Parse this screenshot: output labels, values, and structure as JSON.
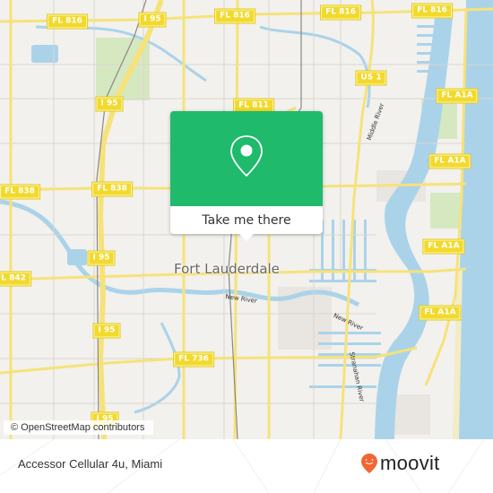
{
  "map": {
    "city_label": "Fort Lauderdale",
    "road_shields": [
      {
        "label": "FL 816"
      },
      {
        "label": "I 95"
      },
      {
        "label": "FL 816"
      },
      {
        "label": "FL 816"
      },
      {
        "label": "FL 816"
      },
      {
        "label": "I 95"
      },
      {
        "label": "FL 811"
      },
      {
        "label": "US 1"
      },
      {
        "label": "FL A1A"
      },
      {
        "label": "FL 838"
      },
      {
        "label": "FL 838"
      },
      {
        "label": "FL A1A"
      },
      {
        "label": "FL A1A"
      },
      {
        "label": "I 95"
      },
      {
        "label": "FL 842"
      },
      {
        "label": "FL A1A"
      },
      {
        "label": "I 95"
      },
      {
        "label": "FL 736"
      },
      {
        "label": "I 95"
      }
    ],
    "water_labels": {
      "middle_river": "Middle River",
      "new_river_1": "New River",
      "new_river_2": "New River",
      "stranahan_river": "Stranahan River"
    },
    "colors": {
      "land": "#f2f1ed",
      "water": "#aad3ea",
      "road": "#f6e27a",
      "park": "#d6e8c0"
    }
  },
  "popup": {
    "icon": "map-pin-icon",
    "button_label": "Take me there",
    "color": "#1fba6b"
  },
  "attribution": "© OpenStreetMap contributors",
  "footer": {
    "place_name": "Accessor Cellular 4u, Miami",
    "brand": "moovit",
    "brand_color": "#f26631"
  }
}
